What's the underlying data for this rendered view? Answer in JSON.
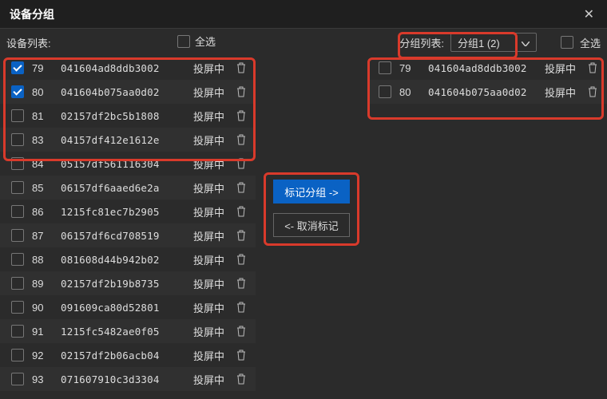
{
  "window": {
    "title": "设备分组"
  },
  "toolbar": {
    "left_label": "设备列表:",
    "left_selectall": "全选",
    "right_label": "分组列表:",
    "group_selected": "分组1 (2)",
    "right_selectall": "全选"
  },
  "buttons": {
    "mark": "标记分组 ->",
    "unmark": "<- 取消标记"
  },
  "status_text": "投屏中",
  "left_list": [
    {
      "num": "79",
      "id": "041604ad8ddb3002",
      "checked": true
    },
    {
      "num": "80",
      "id": "041604b075aa0d02",
      "checked": true
    },
    {
      "num": "81",
      "id": "02157df2bc5b1808",
      "checked": false
    },
    {
      "num": "83",
      "id": "04157df412e1612e",
      "checked": false
    },
    {
      "num": "84",
      "id": "05157df561116304",
      "checked": false
    },
    {
      "num": "85",
      "id": "06157df6aaed6e2a",
      "checked": false
    },
    {
      "num": "86",
      "id": "1215fc81ec7b2905",
      "checked": false
    },
    {
      "num": "87",
      "id": "06157df6cd708519",
      "checked": false
    },
    {
      "num": "88",
      "id": "081608d44b942b02",
      "checked": false
    },
    {
      "num": "89",
      "id": "02157df2b19b8735",
      "checked": false
    },
    {
      "num": "90",
      "id": "091609ca80d52801",
      "checked": false
    },
    {
      "num": "91",
      "id": "1215fc5482ae0f05",
      "checked": false
    },
    {
      "num": "92",
      "id": "02157df2b06acb04",
      "checked": false
    },
    {
      "num": "93",
      "id": "071607910c3d3304",
      "checked": false
    }
  ],
  "right_list": [
    {
      "num": "79",
      "id": "041604ad8ddb3002",
      "checked": false
    },
    {
      "num": "80",
      "id": "041604b075aa0d02",
      "checked": false
    }
  ]
}
